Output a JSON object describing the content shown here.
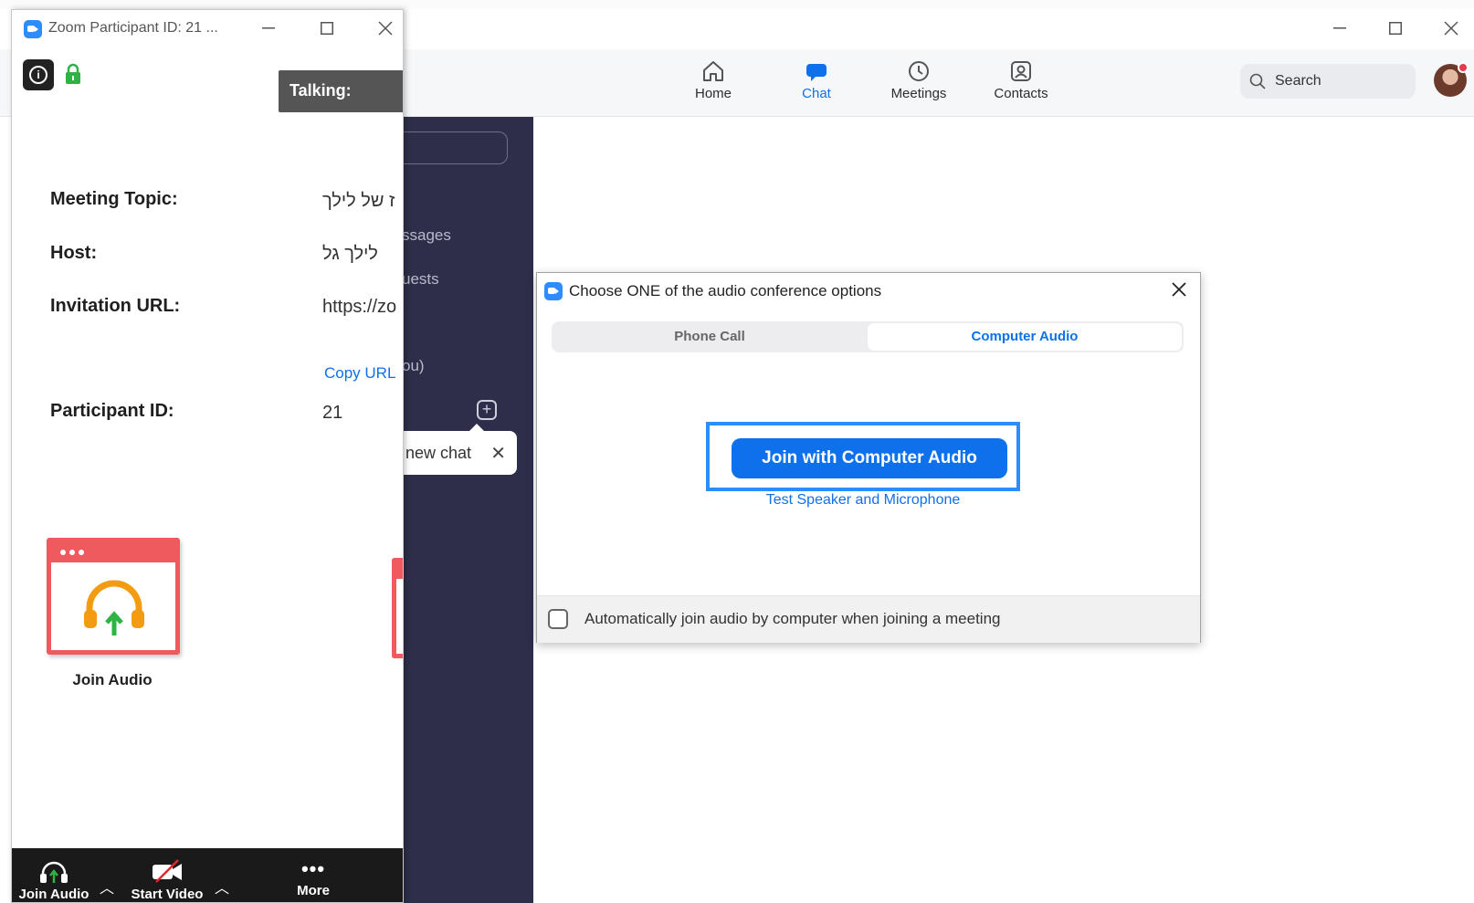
{
  "main": {
    "nav": [
      {
        "label": "Home",
        "icon": "home-icon"
      },
      {
        "label": "Chat",
        "icon": "chat-icon"
      },
      {
        "label": "Meetings",
        "icon": "clock-icon"
      },
      {
        "label": "Contacts",
        "icon": "contacts-icon"
      }
    ],
    "search_label": "Search",
    "sidebar": {
      "messages_partial": "ssages",
      "requests_partial": "uests",
      "you_partial": "ou)",
      "new_chat_tip": "new chat"
    }
  },
  "participant_window": {
    "title": "Zoom Participant ID: 21 ...",
    "talking": "Talking:",
    "info": {
      "topic_label": "Meeting Topic:",
      "topic_value": "ז של לילך",
      "host_label": "Host:",
      "host_value": "לילך גל",
      "url_label": "Invitation URL:",
      "url_value": "https://zo",
      "copy_url": "Copy URL",
      "pid_label": "Participant ID:",
      "pid_value": "21"
    },
    "join_audio_tile_label": "Join Audio",
    "toolbar": {
      "join_audio": "Join Audio",
      "start_video": "Start Video",
      "more": "More"
    }
  },
  "audio_dialog": {
    "title": "Choose ONE of the audio conference options",
    "tabs": [
      "Phone Call",
      "Computer Audio"
    ],
    "active_tab": "Computer Audio",
    "join_button": "Join with Computer Audio",
    "test_link": "Test Speaker and Microphone",
    "auto_join_label": "Automatically join audio by computer when joining a meeting",
    "auto_join_checked": false
  },
  "colors": {
    "accent": "#0e71eb",
    "sidebar": "#2e2e4a",
    "tile_red": "#ef5a5f",
    "toolbar": "#1a1a1a"
  }
}
